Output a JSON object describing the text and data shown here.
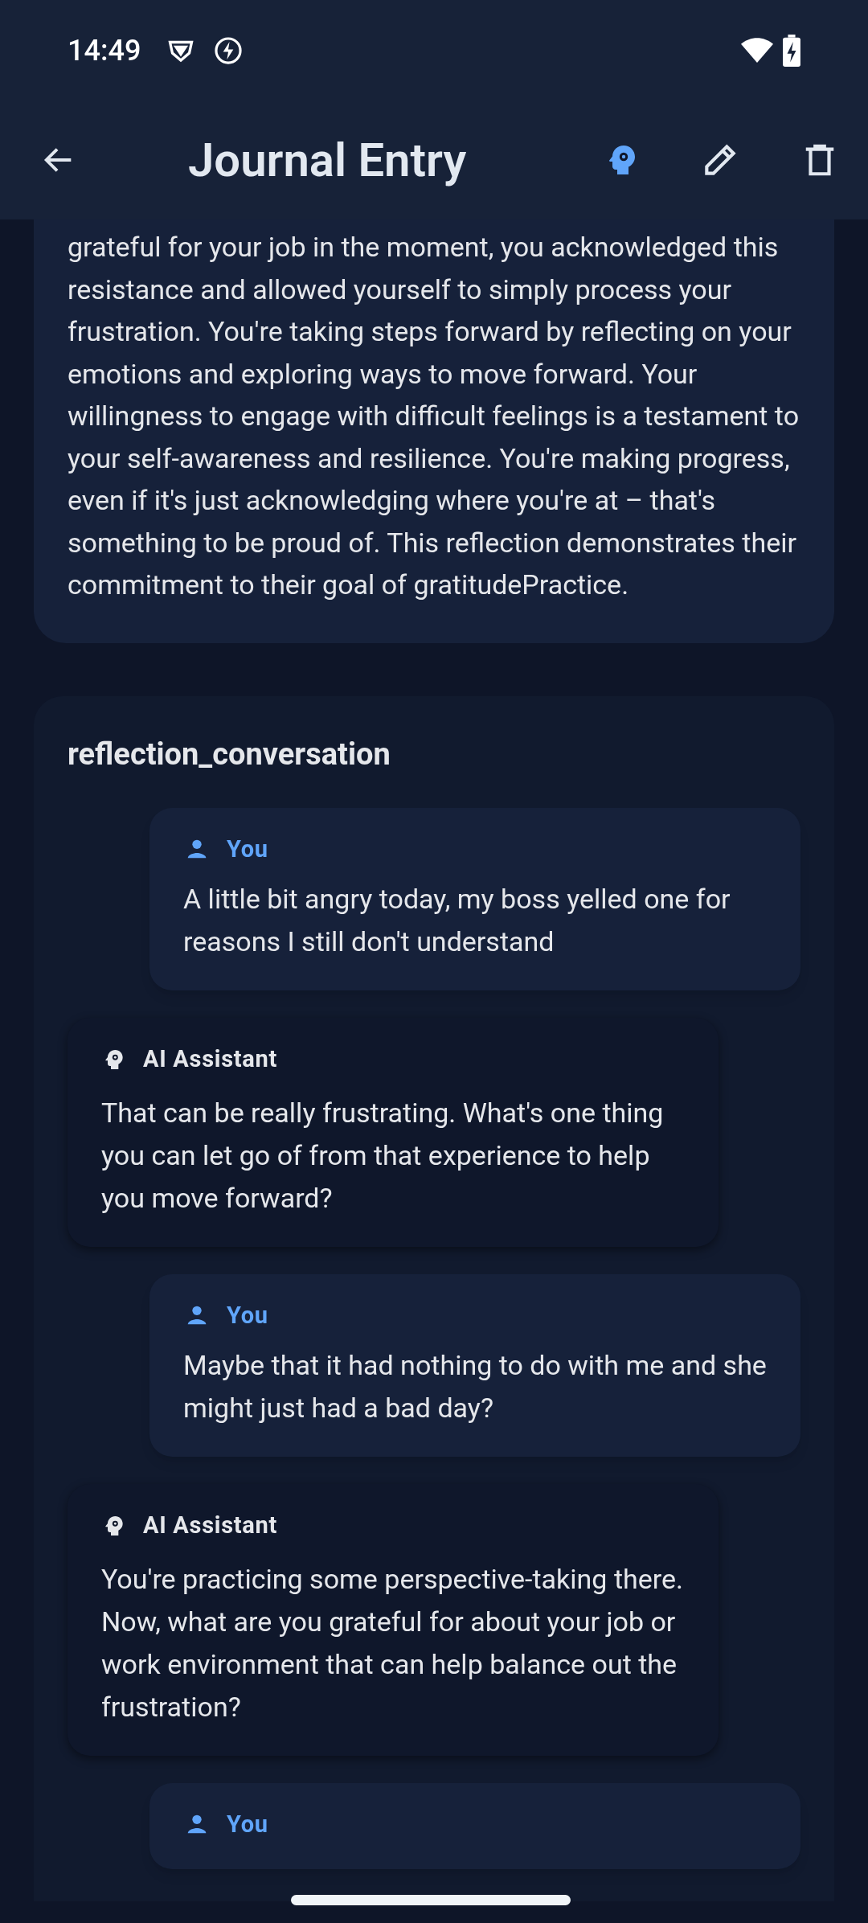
{
  "status_bar": {
    "time": "14:49"
  },
  "app_bar": {
    "title": "Journal Entry"
  },
  "summary": {
    "text": "grateful for your job in the moment, you acknowledged this resistance and allowed yourself to simply process your frustration. You're taking steps forward by reflecting on your emotions and exploring ways to move forward. Your willingness to engage with difficult feelings is a testament to your self-awareness and resilience. You're making progress, even if it's just acknowledging where you're at – that's something to be proud of. This reflection demonstrates their commitment to their goal of gratitudePractice."
  },
  "conversation": {
    "title": "reflection_conversation",
    "messages": [
      {
        "kind": "user",
        "author": "You",
        "text": "A little bit angry today, my boss yelled one for reasons I still don't understand"
      },
      {
        "kind": "ai",
        "author": "AI Assistant",
        "text": "That can be really frustrating. What's one thing you can let go of from that experience to help you move forward?"
      },
      {
        "kind": "user",
        "author": "You",
        "text": "Maybe that it had nothing to do with me and she might just had a bad day?"
      },
      {
        "kind": "ai",
        "author": "AI Assistant",
        "text": "You're practicing some perspective-taking there. Now, what are you grateful for about your job or work environment that can help balance out the frustration?"
      },
      {
        "kind": "user",
        "author": "You"
      }
    ]
  }
}
